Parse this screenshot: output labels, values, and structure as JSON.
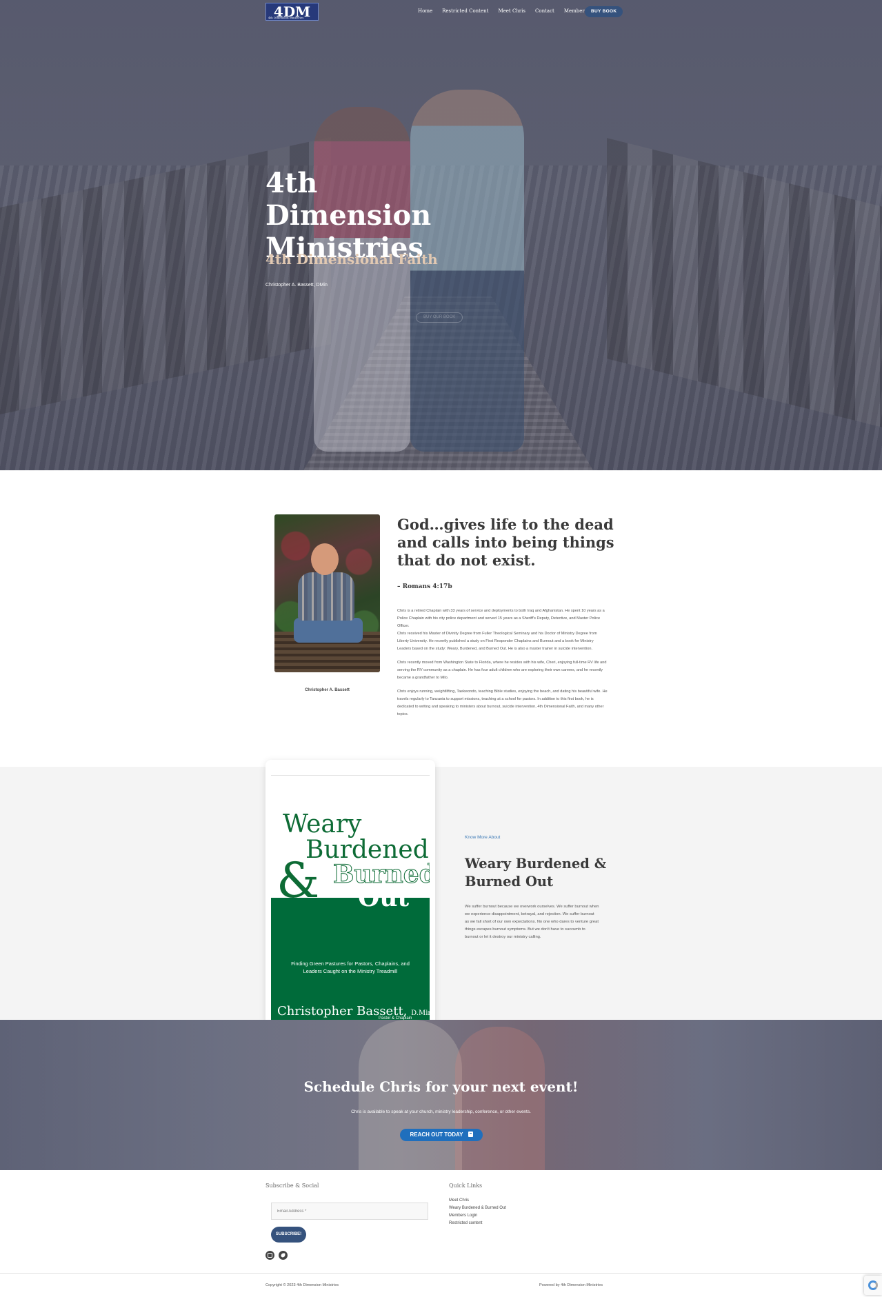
{
  "header": {
    "logo_text": "4DM",
    "logo_small": "4th Dimension Ministries",
    "nav": [
      {
        "label": "Home"
      },
      {
        "label": "Restricted Content"
      },
      {
        "label": "Meet Chris"
      },
      {
        "label": "Contact"
      },
      {
        "label": "Member Login"
      }
    ],
    "buy_button": "BUY BOOK"
  },
  "hero": {
    "title": "4th Dimension Ministries",
    "subtitle": "4th Dimensional Faith",
    "author": "Christopher A. Bassett, DMin",
    "ghost_button": "BUY OUR BOOK"
  },
  "about": {
    "photo_caption": "Christopher A. Bassett",
    "verse": "God…gives life to the dead and calls into being things that do not exist.",
    "verse_ref": "– Romans 4:17b",
    "bio": [
      "Chris is a retired Chaplain with 33 years of service and deployments to both Iraq and Afghanistan. He spent 10 years as a Police Chaplain with his city police department and served 15 years as a Sheriff's Deputy, Detective, and Master Police Officer.",
      "Chris received his Master of Divinity Degree from Fuller Theological Seminary and his Doctor of Ministry Degree from Liberty University. He recently published a study on First Responder Chaplains and Burnout and a book for Ministry Leaders based on the study: Weary, Burdened, and Burned Out. He is also a master trainer in suicide intervention.",
      "Chris recently moved from Washington State to Florida, where he resides with his wife, Cheri, enjoying full-time RV life and serving the RV community as a chaplain. He has four adult children who are exploring their own careers, and he recently became a grandfather to Milo.",
      "Chris enjoys running, weightlifting, Taekwondo, teaching Bible studies, enjoying the beach, and dating his beautiful wife. He travels regularly to Tanzania to support missions, teaching at a school for pastors. In addition to this first book, he is dedicated to writing and speaking to ministers about burnout, suicide intervention, 4th Dimensional Faith, and many other topics."
    ]
  },
  "book": {
    "cover": {
      "word1": "Weary",
      "word2": "Burdened",
      "ampersand": "&",
      "word3": "Burned",
      "word4": "Out",
      "tagline": "Finding Green Pastures for Pastors, Chaplains, and Leaders Caught on the Ministry Treadmill",
      "author": "Christopher Bassett,",
      "degree": "D.Min.",
      "role": "Pastor & Chaplain",
      "green": "#006b3a"
    },
    "know_more": "Know More About",
    "title": "Weary Burdened & Burned Out",
    "description": "We suffer burnout because we overwork ourselves. We suffer burnout when we experience disappointment, betrayal, and rejection. We suffer burnout as we fall short of our own expectations. No one who dares to venture great things escapes burnout symptoms. But we don't have to succumb to burnout or let it destroy our ministry calling."
  },
  "schedule": {
    "title": "Schedule Chris for your next event!",
    "text": "Chris is available to speak at your church, ministry leadership, conference, or other events.",
    "button": "REACH OUT TODAY",
    "button_icon": "book-icon",
    "button_color": "#1f6fbd"
  },
  "footer": {
    "subscribe_heading": "Subscribe & Social",
    "email_placeholder": "Email Address *",
    "subscribe_button": "SUBSCRIBE!",
    "social_icons": [
      "facebook-icon",
      "twitter-icon"
    ],
    "quick_links_heading": "Quick Links",
    "quick_links": [
      "Meet Chris",
      "Weary Burdened & Burned Out",
      "Members Login",
      "Restricted content"
    ],
    "copyright": "Copyright © 2023 4th Dimension Ministries",
    "powered": "Powered by 4th Dimension Ministries"
  }
}
